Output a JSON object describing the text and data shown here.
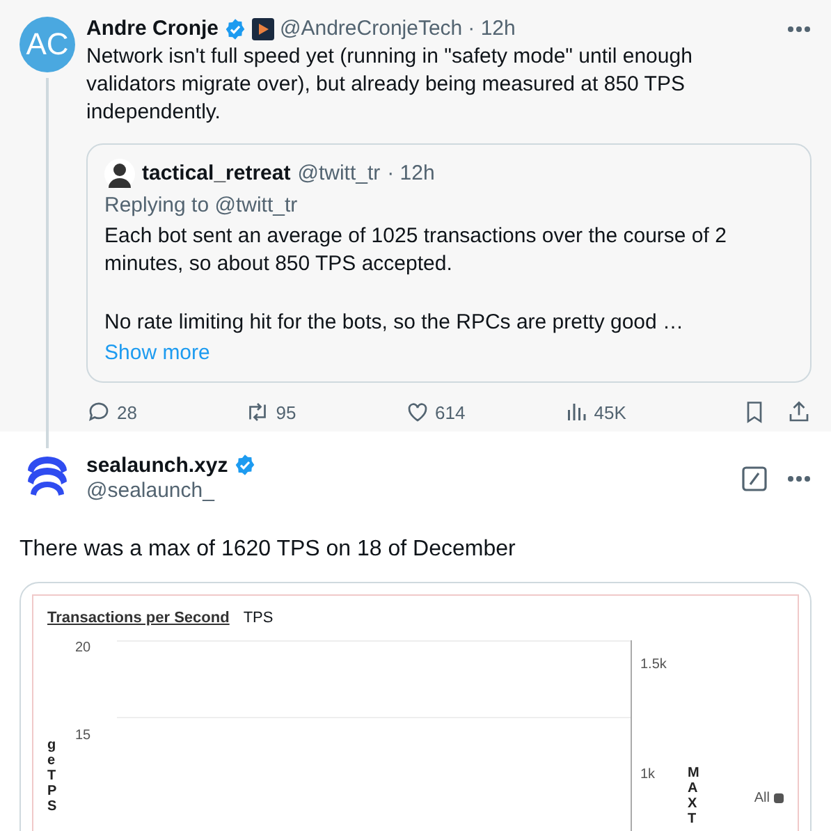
{
  "thread": {
    "author": {
      "name": "Andre Cronje",
      "avatar_text": "AC",
      "verified": true,
      "handle": "@AndreCronjeTech",
      "time": "· 12h"
    },
    "text": "Network isn't full speed yet (running in \"safety mode\" until enough validators migrate over), but already being measured at 850 TPS independently.",
    "quote": {
      "name": "tactical_retreat",
      "handle": "@twitt_tr",
      "time": "· 12h",
      "replying": "Replying to @twitt_tr",
      "paragraphs": [
        "Each bot sent an average of 1025 transactions over the course of 2 minutes, so about 850 TPS accepted.",
        "No rate limiting hit for the bots, so the RPCs are pretty good …"
      ],
      "show_more": "Show more"
    },
    "actions": [
      {
        "kind": "reply",
        "count": "28"
      },
      {
        "kind": "repost",
        "count": "95"
      },
      {
        "kind": "like",
        "count": "614"
      },
      {
        "kind": "views",
        "count": "45K"
      },
      {
        "kind": "bookmark"
      },
      {
        "kind": "share"
      }
    ]
  },
  "reply": {
    "author": {
      "name": "sealaunch.xyz",
      "verified": true,
      "handle": "@sealaunch_"
    },
    "text": "There was a max of 1620 TPS on 18 of December",
    "chart_image": {
      "title": "Transactions per Second",
      "tag": "TPS",
      "left_ticks": [
        "20",
        "15"
      ],
      "right_ticks": [
        "1.5k",
        "1k"
      ],
      "left_axis_label": "ge TPS",
      "right_axis_label": "MAX T",
      "legend": [
        {
          "label": "All",
          "color": "#555555"
        }
      ]
    }
  }
}
